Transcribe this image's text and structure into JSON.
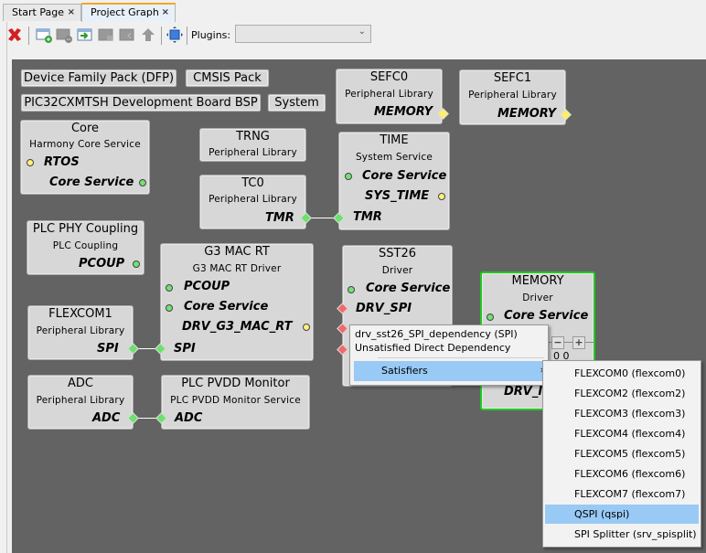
{
  "tabs": [
    {
      "label": "Start Page",
      "close": "×",
      "active": false
    },
    {
      "label": "Project Graph",
      "close": "×",
      "active": true
    }
  ],
  "toolbar": {
    "icons": [
      "delete-icon",
      "add-group-icon",
      "remove-group-icon",
      "move-into-group-icon",
      "group-disabled-icon",
      "group-out-disabled-icon",
      "move-up-icon",
      "fit-view-icon"
    ],
    "plugins_label": "Plugins:",
    "plugins_value": ""
  },
  "pills": [
    {
      "label": "Device Family Pack (DFP)"
    },
    {
      "label": "CMSIS Pack"
    },
    {
      "label": "PIC32CXMTSH Development Board BSP"
    },
    {
      "label": "System"
    }
  ],
  "components": {
    "core": {
      "title": "Core",
      "subtitle": "Harmony Core Service",
      "ports": [
        "RTOS",
        "Core Service"
      ]
    },
    "trng": {
      "title": "TRNG",
      "subtitle": "Peripheral Library"
    },
    "tc0": {
      "title": "TC0",
      "subtitle": "Peripheral Library",
      "ports": [
        "TMR"
      ]
    },
    "sefc0": {
      "title": "SEFC0",
      "subtitle": "Peripheral Library",
      "ports": [
        "MEMORY"
      ]
    },
    "sefc1": {
      "title": "SEFC1",
      "subtitle": "Peripheral Library",
      "ports": [
        "MEMORY"
      ]
    },
    "time": {
      "title": "TIME",
      "subtitle": "System Service",
      "ports": [
        "Core Service",
        "SYS_TIME",
        "TMR"
      ]
    },
    "plcphy": {
      "title": "PLC PHY Coupling",
      "subtitle": "PLC Coupling",
      "ports": [
        "PCOUP"
      ]
    },
    "g3mac": {
      "title": "G3 MAC RT",
      "subtitle": "G3 MAC RT Driver",
      "ports": [
        "PCOUP",
        "Core Service",
        "DRV_G3_MAC_RT",
        "SPI"
      ]
    },
    "flexcom1": {
      "title": "FLEXCOM1",
      "subtitle": "Peripheral Library",
      "ports": [
        "SPI"
      ]
    },
    "adc": {
      "title": "ADC",
      "subtitle": "Peripheral Library",
      "ports": [
        "ADC"
      ]
    },
    "plcpvdd": {
      "title": "PLC PVDD Monitor",
      "subtitle": "PLC PVDD Monitor Service",
      "ports": [
        "ADC"
      ]
    },
    "sst26": {
      "title": "SST26",
      "subtitle": "Driver",
      "ports": [
        "Core Service",
        "DRV_SPI"
      ]
    },
    "memory": {
      "title": "MEMORY",
      "subtitle": "Driver",
      "ports": [
        "Core Service",
        "DRV_I"
      ],
      "instance_label": "0 0",
      "minus": "−",
      "plus": "+"
    }
  },
  "context_menu": {
    "dependency": "drv_sst26_SPI_dependency (SPI)",
    "status": "Unsatisfied Direct Dependency",
    "satisfiers_label": "Satisfiers",
    "arrow": "›"
  },
  "submenu": {
    "items": [
      {
        "label": "FLEXCOM0 (flexcom0)",
        "highlighted": false
      },
      {
        "label": "FLEXCOM2 (flexcom2)",
        "highlighted": false
      },
      {
        "label": "FLEXCOM3 (flexcom3)",
        "highlighted": false
      },
      {
        "label": "FLEXCOM4 (flexcom4)",
        "highlighted": false
      },
      {
        "label": "FLEXCOM5 (flexcom5)",
        "highlighted": false
      },
      {
        "label": "FLEXCOM6 (flexcom6)",
        "highlighted": false
      },
      {
        "label": "FLEXCOM7 (flexcom7)",
        "highlighted": false
      },
      {
        "label": "QSPI (qspi)",
        "highlighted": true
      },
      {
        "label": "SPI Splitter (srv_spisplit)",
        "highlighted": false
      }
    ]
  },
  "colors": {
    "canvas": "#636363",
    "node": "#d7d7d7",
    "selected_border": "#22c922",
    "satisfied_port": "#73e073",
    "provided_port": "#fff07a",
    "unsatisfied_port": "#f06a6a",
    "menu_highlight": "#99c9f5"
  }
}
